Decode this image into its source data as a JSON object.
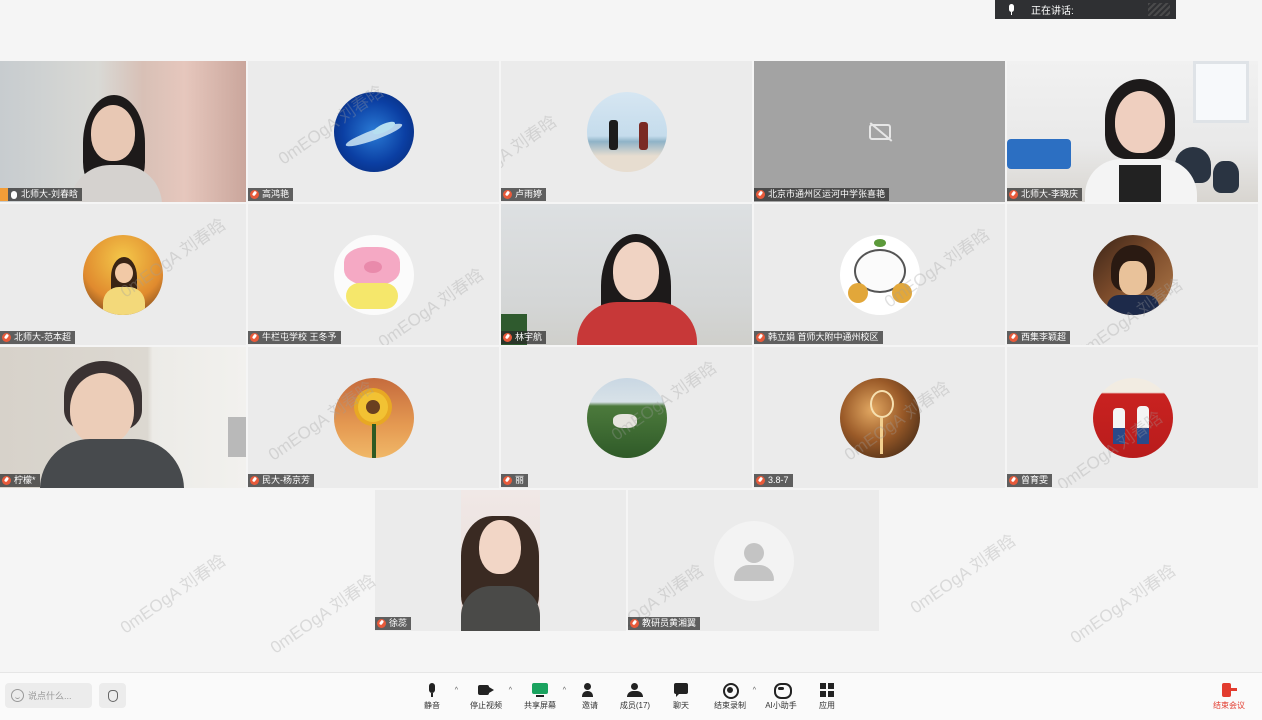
{
  "speaking": {
    "label": "正在讲话:"
  },
  "watermark": "0mEOgA 刘春晗",
  "participants": [
    {
      "name": "北师大-刘春晗",
      "kind": "video",
      "host": true
    },
    {
      "name": "高鸿艳",
      "kind": "avatar",
      "avatar": "earth"
    },
    {
      "name": "卢雨婷",
      "kind": "avatar",
      "avatar": "couple-beach"
    },
    {
      "name": "北京市通州区运河中学张喜艳",
      "kind": "camera-off"
    },
    {
      "name": "北师大-李晓庆",
      "kind": "video"
    },
    {
      "name": "北师大-范本超",
      "kind": "avatar",
      "avatar": "girl-stars"
    },
    {
      "name": "牛栏屯学校 王冬予",
      "kind": "avatar",
      "avatar": "pink-pig"
    },
    {
      "name": "林宇航",
      "kind": "video"
    },
    {
      "name": "韩立娟 首师大附中通州校区",
      "kind": "avatar",
      "avatar": "white-cat"
    },
    {
      "name": "西集李颖超",
      "kind": "avatar",
      "avatar": "anime-boy"
    },
    {
      "name": "柠檬*",
      "kind": "video"
    },
    {
      "name": "民大-杨京芳",
      "kind": "avatar",
      "avatar": "sunflower"
    },
    {
      "name": "丽",
      "kind": "avatar",
      "avatar": "field-dog"
    },
    {
      "name": "3.8-7",
      "kind": "avatar",
      "avatar": "lightbulb"
    },
    {
      "name": "曾育雯",
      "kind": "avatar",
      "avatar": "red-poster"
    },
    {
      "name": "徐蕊",
      "kind": "video"
    },
    {
      "name": "教研员黄湘翼",
      "kind": "avatar",
      "avatar": "default-user"
    }
  ],
  "toolbar": {
    "say_placeholder": "说点什么...",
    "buttons": [
      {
        "id": "mute",
        "label": "静音",
        "icon": "mic-icon"
      },
      {
        "id": "stop-video",
        "label": "停止视频",
        "icon": "video-icon"
      },
      {
        "id": "share",
        "label": "共享屏幕",
        "icon": "share-screen-icon"
      },
      {
        "id": "invite",
        "label": "邀请",
        "icon": "invite-icon"
      },
      {
        "id": "members",
        "label": "成员(17)",
        "icon": "members-icon"
      },
      {
        "id": "chat",
        "label": "聊天",
        "icon": "chat-icon"
      },
      {
        "id": "record",
        "label": "结束录制",
        "icon": "record-icon"
      },
      {
        "id": "ai",
        "label": "AI小助手",
        "icon": "ai-assistant-icon"
      },
      {
        "id": "apps",
        "label": "应用",
        "icon": "apps-icon"
      }
    ],
    "end_label": "结束会议",
    "colors": {
      "share": "#1aa35f",
      "end": "#e23b2e"
    }
  }
}
